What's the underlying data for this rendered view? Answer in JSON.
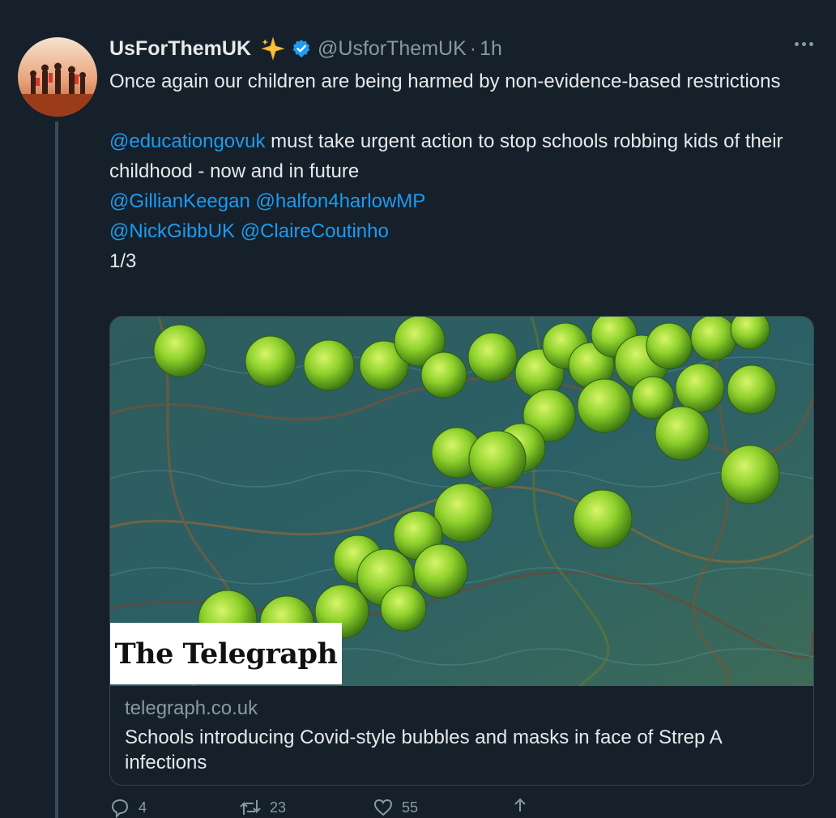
{
  "tweet": {
    "display_name": "UsForThemUK",
    "handle": "@UsforThemUK",
    "separator": "·",
    "time": "1h",
    "emoji_icon": "sparkle-star-icon",
    "verified_icon": "verified-badge-icon",
    "text": {
      "line1": "Once again our children are being harmed by non-evidence-based restrictions",
      "mention_education": "@educationgovuk",
      "line2": " must take urgent action to stop schools robbing kids of their childhood - now and in future",
      "mention_keegan": "@GillianKeegan",
      "mention_halfon": "@halfon4harlowMP",
      "mention_gibb": "@NickGibbUK",
      "mention_coutinho": "@ClaireCoutinho",
      "thread_count": "1/3"
    }
  },
  "card": {
    "image": "green-bacteria-spheres-illustration",
    "logo_text": "The Telegraph",
    "domain": "telegraph.co.uk",
    "title": "Schools introducing Covid-style bubbles and masks in face of Strep A infections"
  },
  "actions": {
    "reply_count": "4",
    "retweet_count": "23",
    "like_count": "55"
  },
  "colors": {
    "background": "#15202b",
    "text": "#e7e9ea",
    "muted": "#8b98a5",
    "accent": "#1d9bf0"
  }
}
